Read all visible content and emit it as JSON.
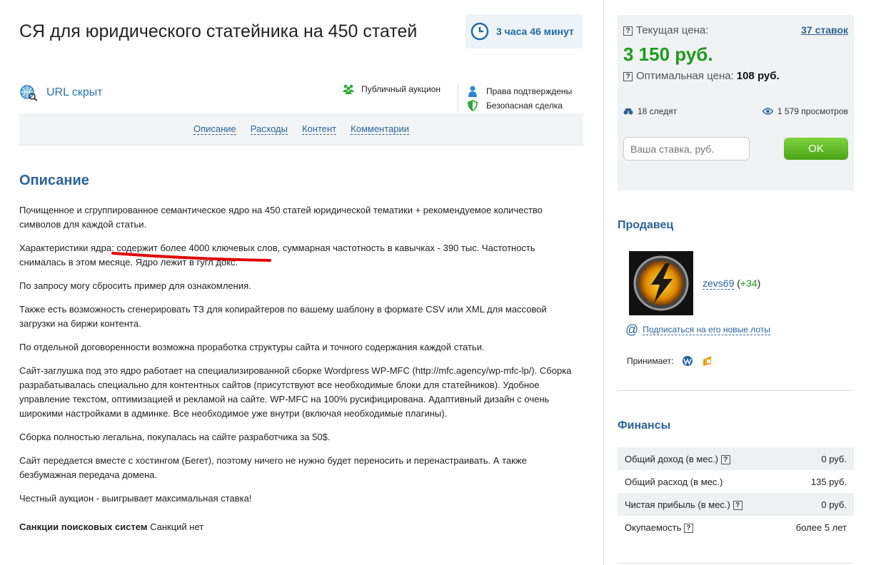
{
  "lot": {
    "title": "СЯ для юридического статейника на 450 статей",
    "time_left": "3 часа 46 минут",
    "url_label": "URL скрыт",
    "auction_type": "Публичный аукцион",
    "rights": "Права подтверждены",
    "safe_deal": "Безопасная сделка"
  },
  "nav": {
    "tabs": [
      "Описание",
      "Расходы",
      "Контент",
      "Комментарии"
    ]
  },
  "description": {
    "heading": "Описание",
    "p1": "Почищенное и сгруппированное семантическое ядро на 450 статей юридической тематики + рекомендуемое количество символов для каждой статьи.",
    "p2_prefix": "Характеристики ядра: ",
    "p2_highlight": "содержит более 4000 ключевых слов",
    "p2_suffix": ", суммарная частотность в кавычках - 390 тыс. Частотность снималась в этом месяце. Ядро лежит в гугл докс.",
    "p3": "По запросу могу сбросить пример для ознакомления.",
    "p4": "Также есть возможность сгенерировать ТЗ для копирайтеров по вашему шаблону в формате CSV или XML для массовой загрузки на биржи контента.",
    "p5": "По отдельной договоренности возможна проработка структуры сайта и точного содержания каждой статьи.",
    "p6": "Сайт-заглушка под это ядро работает на специализированной сборке Wordpress WP-MFC (http://mfc.agency/wp-mfc-lp/). Сборка разрабатывалась специально для контентных сайтов (присутствуют все необходимые блоки для статейников). Удобное управление текстом, оптимизацией и рекламой на сайте. WP-MFC на 100% русифицирована. Адаптивный дизайн с очень широкими настройками в админке. Все необходимое уже внутри (включая необходимые плагины).",
    "p7": "Сборка полностью легальна, покупалась на сайте разработчика за 50$.",
    "p8": "Сайт передается вместе с хостингом (Бегет), поэтому ничего не нужно будет переносить и перенастраивать. А также безбумажная передача домена.",
    "p9": "Честный аукцион - выигрывает максимальная ставка!",
    "sanctions_label": "Санкции поисковых систем",
    "sanctions_value": " Санкций нет"
  },
  "price": {
    "current_label": "Текущая цена:",
    "bids": "37 ставок",
    "current": "3 150 руб.",
    "optimal_label": "Оптимальная цена:",
    "optimal": "108 руб.",
    "watchers": "18 следят",
    "views": "1 579 просмотров",
    "bid_placeholder": "Ваша ставка, руб.",
    "ok": "OK"
  },
  "seller": {
    "heading": "Продавец",
    "name": "zevs69",
    "score_open": " (",
    "score": "+34",
    "score_close": ")",
    "subscribe": "Подписаться на его новые лоты",
    "accepts": "Принимает:"
  },
  "finance": {
    "heading": "Финансы",
    "rows": [
      {
        "label": "Общий доход (в мес.)",
        "value": "0 руб."
      },
      {
        "label": "Общий расход (в мес.)",
        "value": "135 руб."
      },
      {
        "label": "Чистая прибыль (в мес.)",
        "value": "0 руб."
      },
      {
        "label": "Окупаемость",
        "value": "более 5 лет"
      }
    ]
  },
  "colors": {
    "link": "#2a6496",
    "price": "#1c9a1c",
    "ok_button": "#5cba22",
    "underline_mark": "#e00000"
  }
}
